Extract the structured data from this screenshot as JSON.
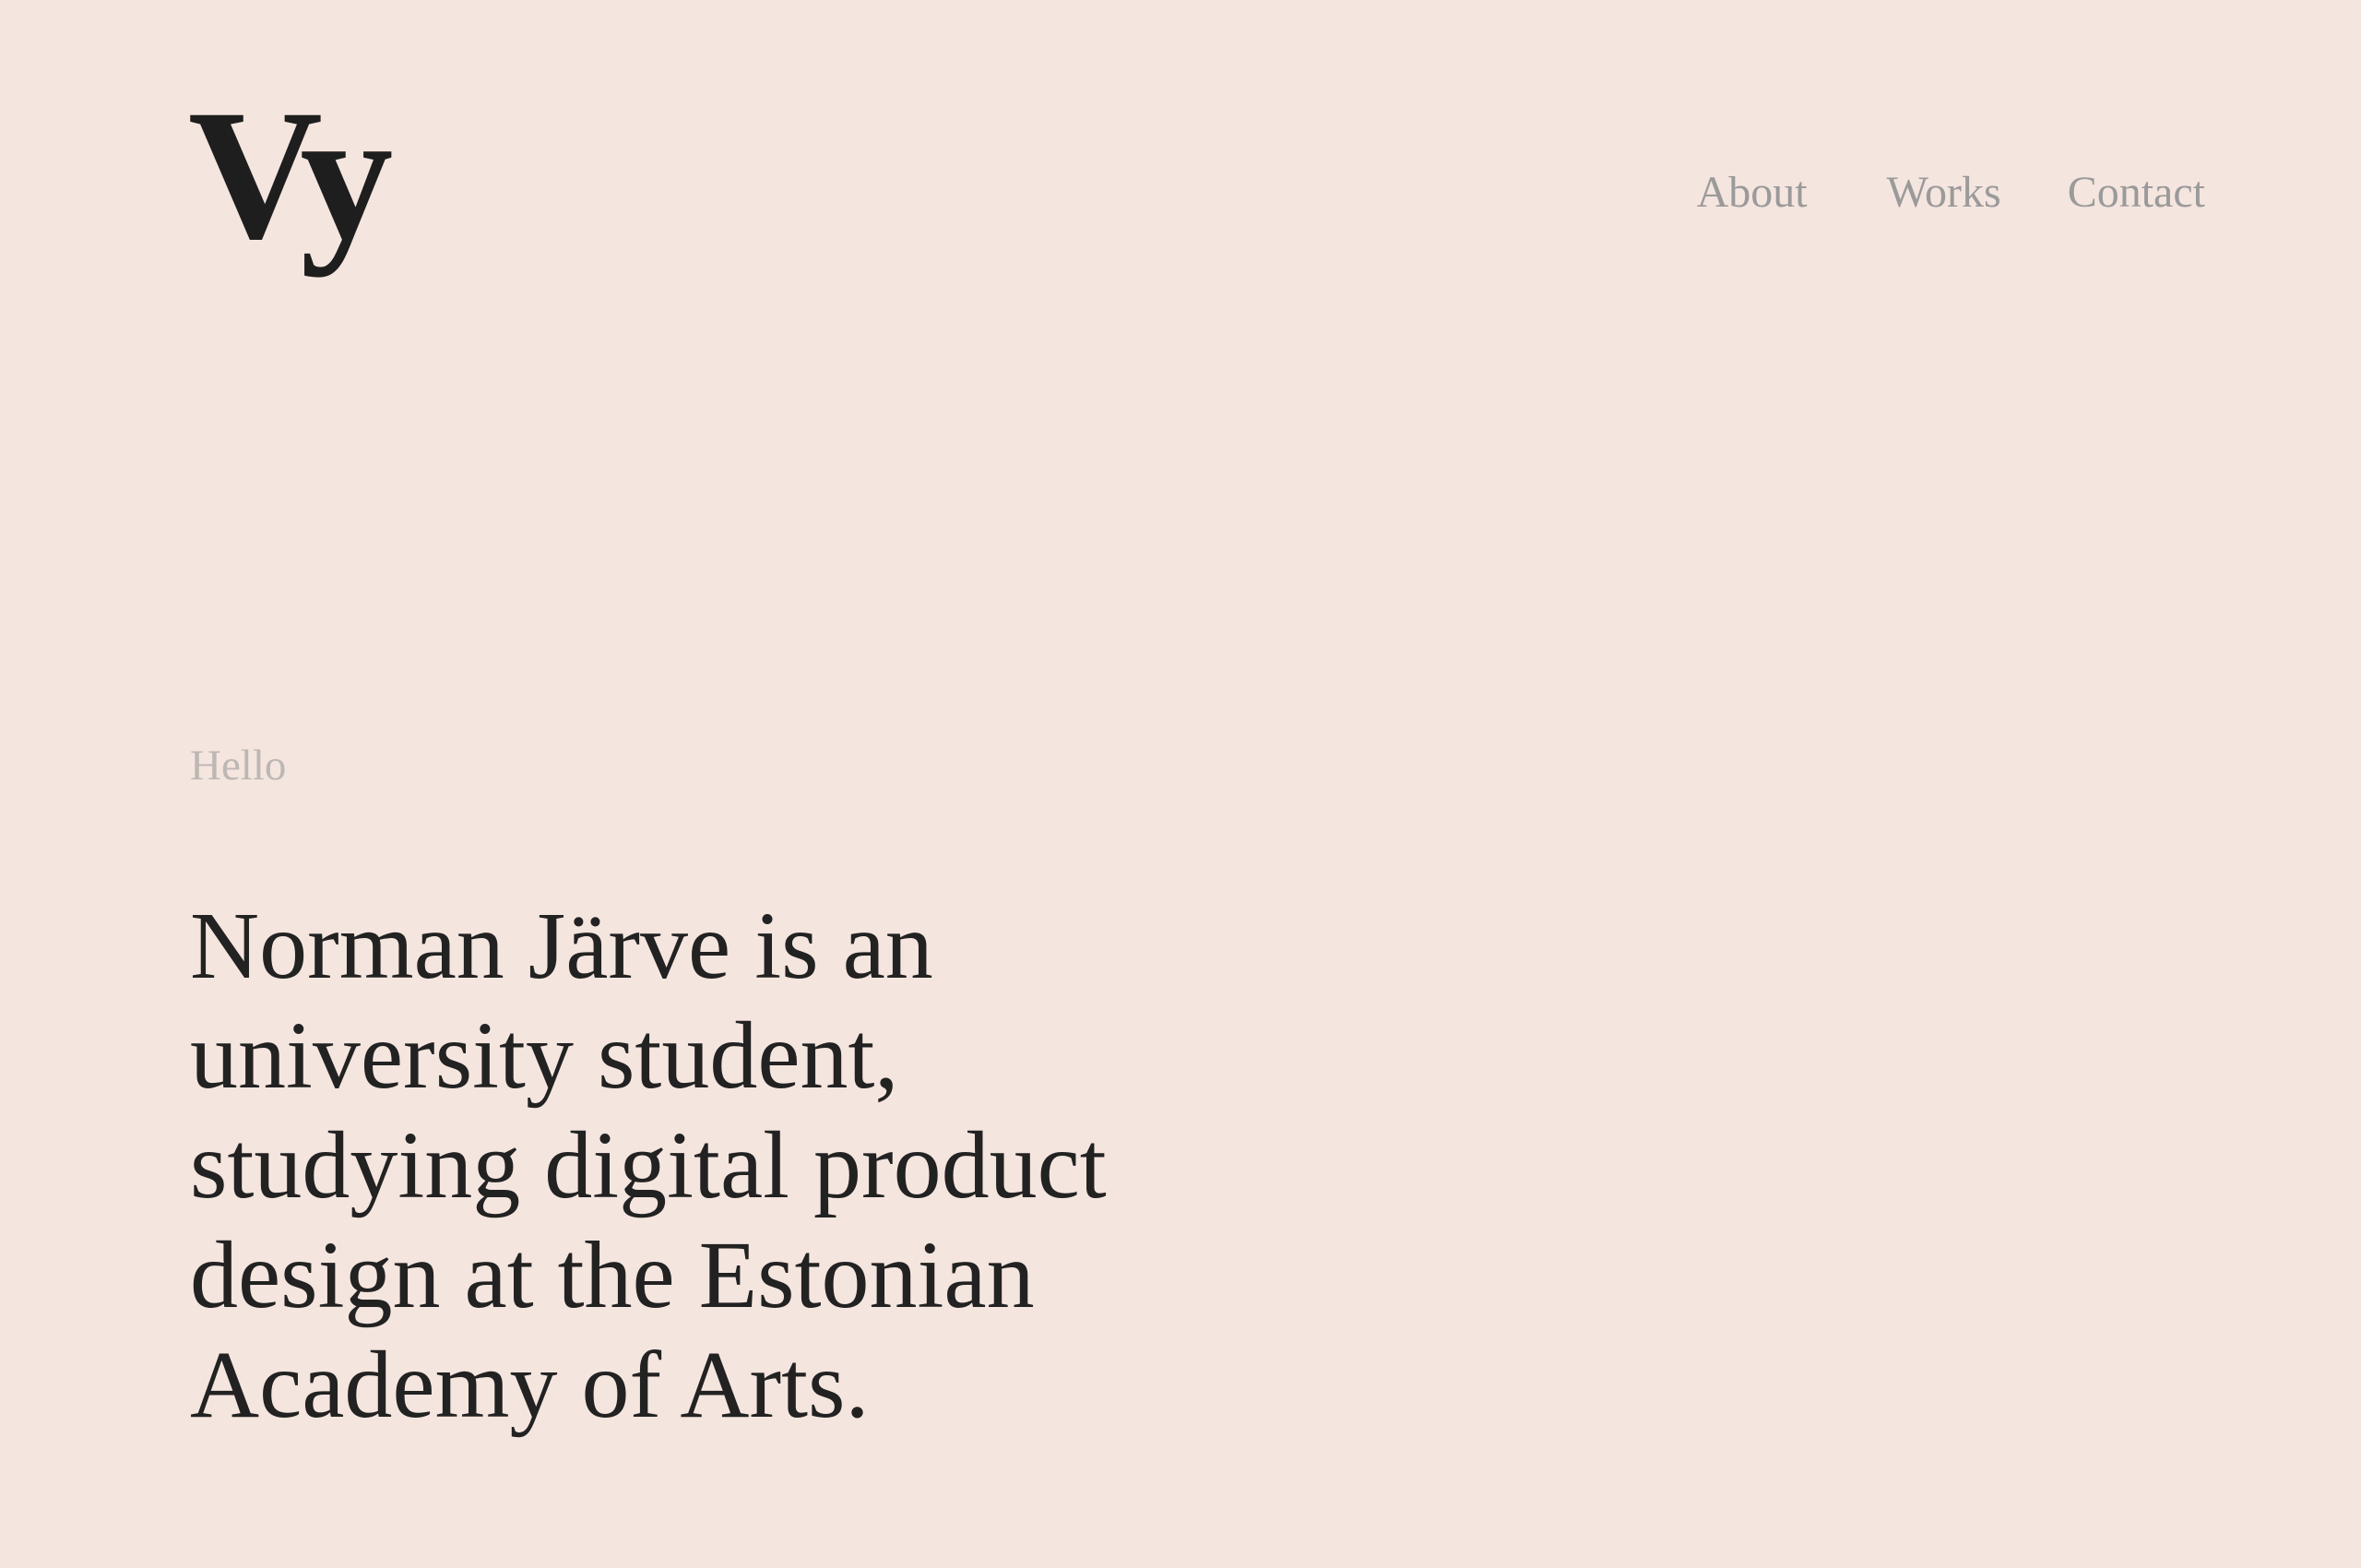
{
  "header": {
    "logo_text": "Vy",
    "nav": [
      {
        "label": "About"
      },
      {
        "label": "Works"
      },
      {
        "label": "Contact"
      }
    ]
  },
  "hero": {
    "greeting": "Hello",
    "intro": "Norman Järve is an university student, studying digital product design at the Estonian Academy of Arts."
  },
  "colors": {
    "background": "#f5e5df",
    "text_primary": "#222222",
    "nav_text": "#9a9a9a",
    "greeting_text": "#bdb7b4"
  }
}
